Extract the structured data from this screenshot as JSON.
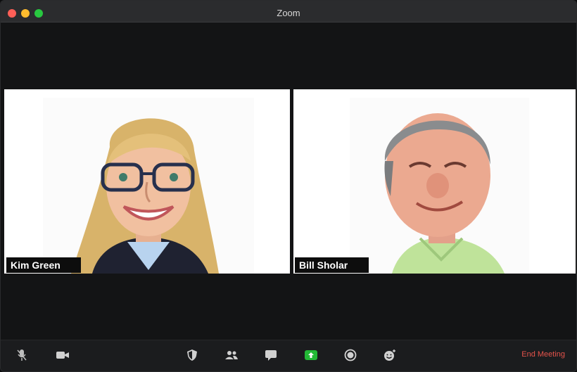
{
  "window": {
    "title": "Zoom"
  },
  "participants": [
    {
      "name": "Kim Green"
    },
    {
      "name": "Bill Sholar"
    }
  ],
  "toolbar": {
    "icons": [
      "mic-muted-icon",
      "video-camera-icon",
      "security-shield-icon",
      "participants-icon",
      "chat-icon",
      "share-screen-icon",
      "record-icon",
      "reactions-icon"
    ],
    "end_meeting": "End Meeting",
    "share_color": "#23b936",
    "end_color": "#e5534b"
  }
}
